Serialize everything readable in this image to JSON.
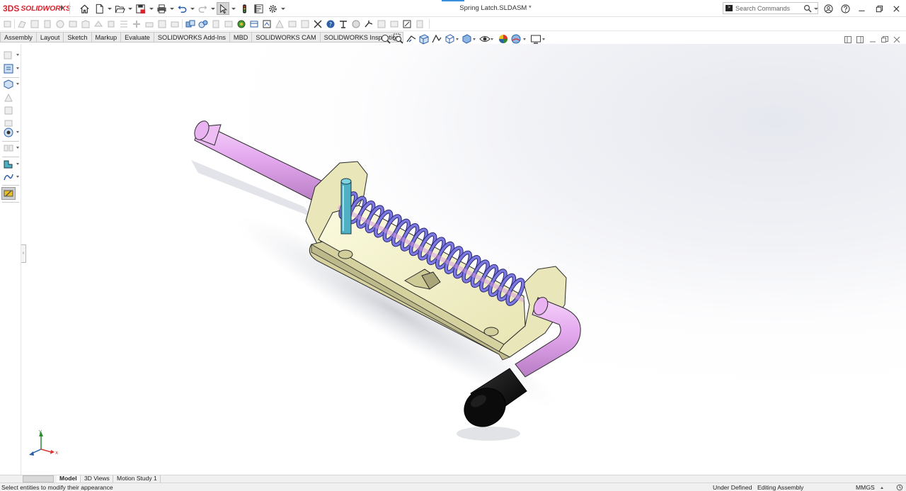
{
  "app": {
    "logo_mark": "3DS",
    "logo_text": "SOLIDWORKS",
    "document_title": "Spring Latch.SLDASM *"
  },
  "search": {
    "placeholder": "Search Commands"
  },
  "command_tabs": [
    {
      "label": "Assembly"
    },
    {
      "label": "Layout"
    },
    {
      "label": "Sketch"
    },
    {
      "label": "Markup"
    },
    {
      "label": "Evaluate"
    },
    {
      "label": "SOLIDWORKS Add-Ins"
    },
    {
      "label": "MBD"
    },
    {
      "label": "SOLIDWORKS CAM"
    },
    {
      "label": "SOLIDWORKS Inspection"
    }
  ],
  "bottom_tabs": [
    {
      "label": "Model",
      "active": true
    },
    {
      "label": "3D Views",
      "active": false
    },
    {
      "label": "Motion Study 1",
      "active": false
    }
  ],
  "triad": {
    "x_label": "x",
    "y_label": "y"
  },
  "status": {
    "message": "Select entities to modify their appearance",
    "definition": "Under Defined",
    "mode": "Editing Assembly",
    "units": "MMGS"
  },
  "model_colors": {
    "plunger": "#e6aef0",
    "spring": "#7b78e0",
    "bracket": "#f3f1c8",
    "pin": "#5ab7c9",
    "knob": "#0c0c0c"
  }
}
